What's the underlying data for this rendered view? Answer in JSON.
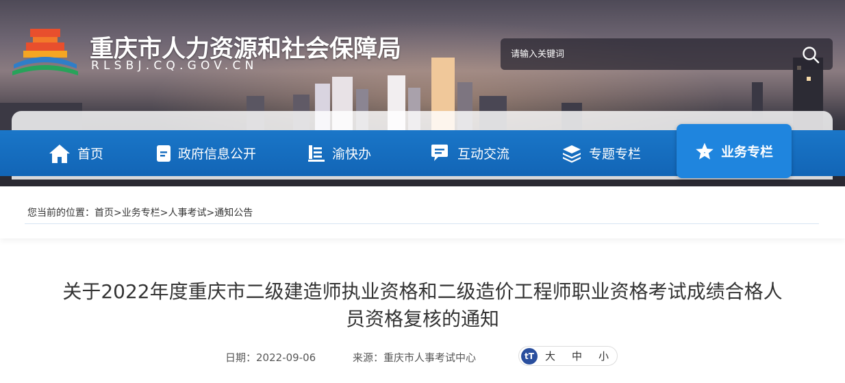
{
  "header": {
    "site_title": "重庆市人力资源和社会保障局",
    "site_domain": "RLSBJ.CQ.GOV.CN",
    "search_placeholder": "请输入关键词"
  },
  "nav": {
    "items": [
      {
        "label": "首页",
        "icon": "home-icon"
      },
      {
        "label": "政府信息公开",
        "icon": "document-icon"
      },
      {
        "label": "渝快办",
        "icon": "service-icon"
      },
      {
        "label": "互动交流",
        "icon": "chat-icon"
      },
      {
        "label": "专题专栏",
        "icon": "layers-icon"
      },
      {
        "label": "业务专栏",
        "icon": "star-icon"
      }
    ],
    "active_index": 5
  },
  "breadcrumb": {
    "prefix": "您当前的位置：",
    "items": [
      "首页",
      "业务专栏",
      "人事考试",
      "通知公告"
    ],
    "separator": ">"
  },
  "article": {
    "title_line1": "关于2022年度重庆市二级建造师执业资格和二级造价工程师职业资格考试成绩合格人",
    "title_line2": "员资格复核的通知",
    "date_label": "日期：",
    "date": "2022-09-06",
    "source_label": "来源：",
    "source": "重庆市人事考试中心",
    "font_sizes": [
      "大",
      "中",
      "小"
    ]
  },
  "colors": {
    "nav_blue": "#1265b6",
    "nav_active": "#1f85de",
    "font_badge": "#2a4f9e"
  }
}
